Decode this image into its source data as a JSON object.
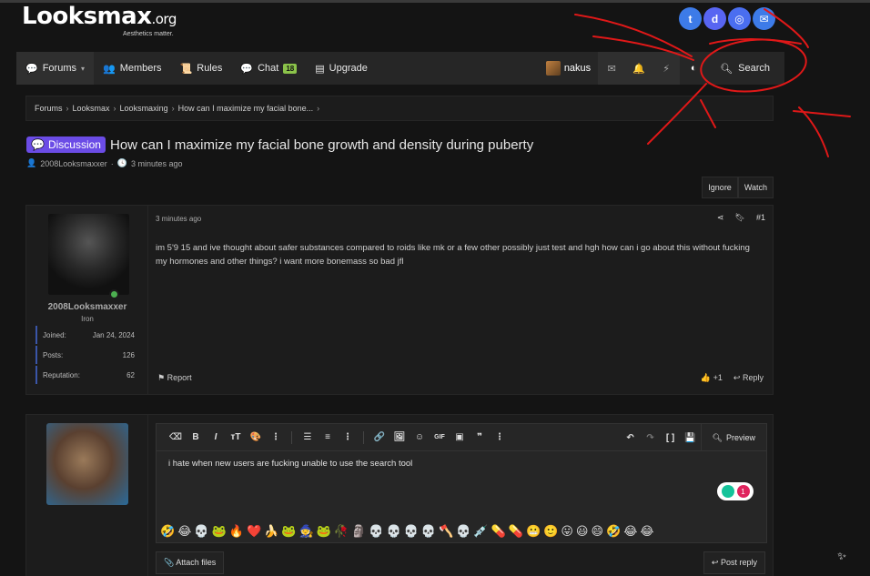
{
  "header": {
    "logo": "Looksmax",
    "logo_suffix": ".org",
    "tagline": "Aesthetics matter.",
    "social_icons": [
      "twitter-icon",
      "discord-icon",
      "instagram-icon",
      "email-icon"
    ]
  },
  "nav": {
    "items": [
      {
        "label": "Forums",
        "icon": "forums-icon",
        "dropdown": true
      },
      {
        "label": "Members",
        "icon": "members-icon",
        "dropdown": true
      },
      {
        "label": "Rules",
        "icon": "rules-icon"
      },
      {
        "label": "Chat",
        "icon": "chat-icon",
        "badge": "18"
      },
      {
        "label": "Upgrade",
        "icon": "upgrade-icon"
      }
    ],
    "username": "nakus",
    "search_label": "Search"
  },
  "breadcrumb": [
    "Forums",
    "Looksmax",
    "Looksmaxing",
    "How can I maximize my facial bone..."
  ],
  "thread": {
    "prefix": "Discussion",
    "title": "How can I maximize my facial bone growth and density during puberty",
    "author": "2008Looksmaxxer",
    "time": "3 minutes ago",
    "ignore_label": "Ignore",
    "watch_label": "Watch"
  },
  "post": {
    "username": "2008Looksmaxxer",
    "user_title": "Iron",
    "stats": [
      {
        "label": "Joined:",
        "value": "Jan 24, 2024"
      },
      {
        "label": "Posts:",
        "value": "126"
      },
      {
        "label": "Reputation:",
        "value": "62"
      }
    ],
    "date": "3 minutes ago",
    "number": "#1",
    "text": "im 5'9 15 and ive thought about safer substances compared to roids like mk or a few other possibly just test and hgh how can i go about this without fucking my hormones and other things? i want more bonemass so bad jfl",
    "report_label": "Report",
    "reaction_count": "+1",
    "reply_label": "Reply"
  },
  "editor": {
    "text": "i hate when new users are fucking unable to use the search tool",
    "preview_label": "Preview",
    "grammarly_count": "1",
    "emojis": [
      "🤣",
      "😂",
      "💀",
      "🐸",
      "🔥",
      "❤️",
      "🍌",
      "🐸",
      "🧙",
      "🐸",
      "🥀",
      "🗿",
      "💀",
      "💀",
      "💀",
      "💀",
      "🪓",
      "💀",
      "💉",
      "💊",
      "💊",
      "😬",
      "🙂",
      "😛",
      "😃",
      "😄",
      "🤣",
      "😂",
      "😂"
    ],
    "attach_label": "Attach files",
    "post_reply_label": "Post reply"
  }
}
